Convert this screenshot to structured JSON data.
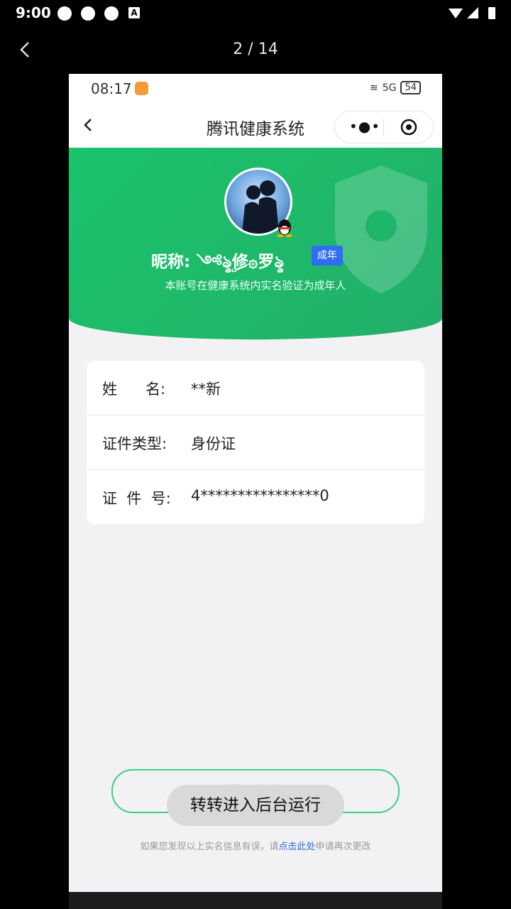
{
  "outer_status": {
    "time": "9:00",
    "a_label": "A"
  },
  "viewer": {
    "counter": "2 / 14"
  },
  "phone": {
    "time": "08:17",
    "network": "5G",
    "battery": "54"
  },
  "nav": {
    "title": "腾讯健康系统"
  },
  "hero": {
    "nickname": "昵称: ༺ৡۣ修۞罗ৡ",
    "badge": "成年",
    "verify_text": "本账号在健康系统内实名验证为成年人"
  },
  "info": {
    "rows": [
      {
        "key": "姓      名:",
        "value": "**新"
      },
      {
        "key": "证件类型:",
        "value": "身份证"
      },
      {
        "key": "证  件  号:",
        "value": "4****************0"
      }
    ]
  },
  "button": {
    "label": "常见问题"
  },
  "toast": {
    "text": "转转进入后台运行"
  },
  "footer": {
    "before": "如果您发现以上实名信息有误，请",
    "link": "点击此处",
    "after": "申请再次更改"
  },
  "colors": {
    "brand_green": "#1fbf6a",
    "badge_blue": "#2f6ef0",
    "link_blue": "#2b6fd6"
  }
}
